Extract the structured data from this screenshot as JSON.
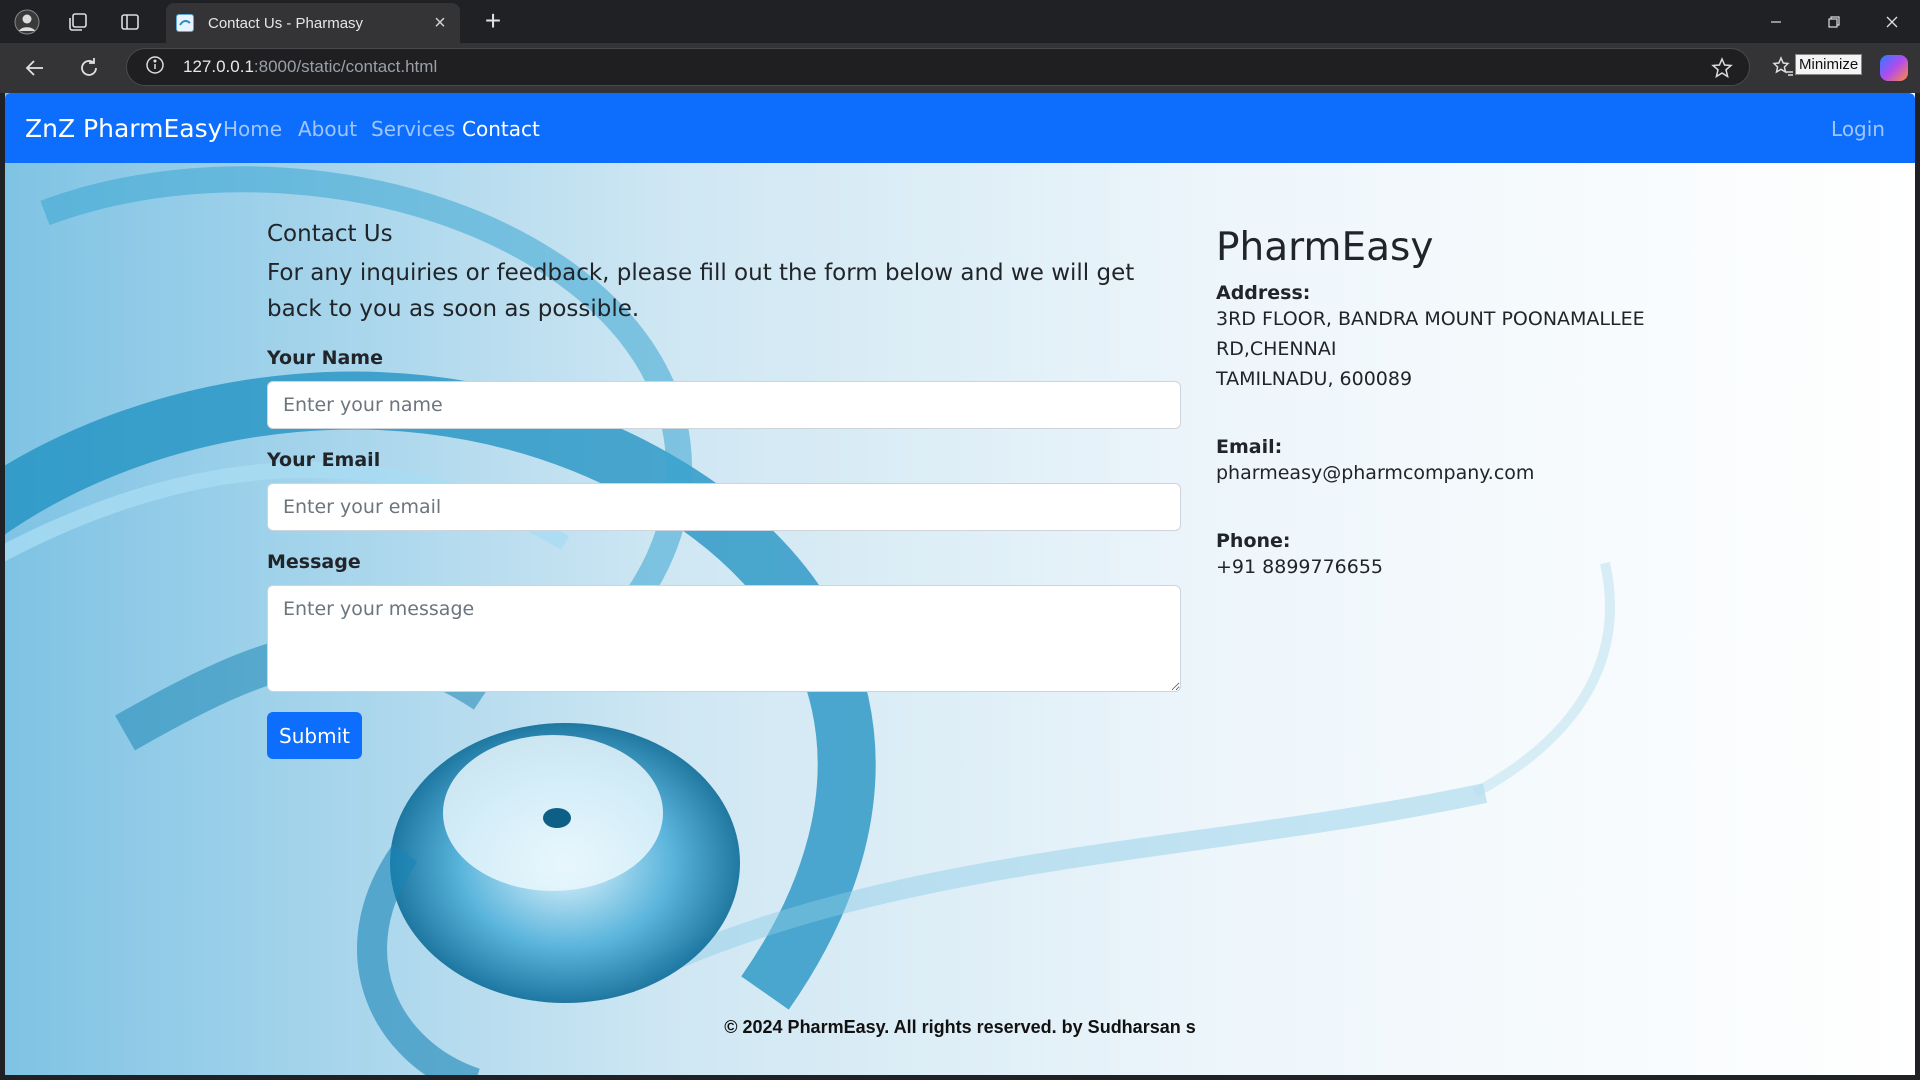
{
  "browser": {
    "tab_title": "Contact Us - Pharmasy",
    "url_host": "127.0.0.1",
    "url_rest": ":8000/static/contact.html",
    "tooltip": "Minimize",
    "icons": [
      "profile-icon",
      "workspaces-icon",
      "tab-actions-icon",
      "close-icon",
      "new-tab-icon",
      "back-icon",
      "reload-icon",
      "site-info-icon",
      "favorite-star-icon",
      "favorites-icon",
      "copilot-icon",
      "minimize-icon",
      "restore-icon",
      "window-close-icon"
    ]
  },
  "navbar": {
    "brand": "ZnZ PharmEasy",
    "links": [
      "Home",
      "About",
      "Services",
      "Contact"
    ],
    "active": "Contact",
    "login": "Login",
    "color": "#0d6efd"
  },
  "form": {
    "title": "Contact Us",
    "intro": "For any inquiries or feedback, please fill out the form below and we will get back to you as soon as possible.",
    "name_label": "Your Name",
    "name_placeholder": "Enter your name",
    "email_label": "Your Email",
    "email_placeholder": "Enter your email",
    "message_label": "Message",
    "message_placeholder": "Enter your message",
    "submit_label": "Submit"
  },
  "info": {
    "title": "PharmEasy",
    "address_label": "Address:",
    "address_line1": "3RD FLOOR, BANDRA MOUNT POONAMALLEE",
    "address_line2": "RD,CHENNAI",
    "address_line3": "TAMILNADU, 600089",
    "email_label": "Email:",
    "email": "pharmeasy@pharmcompany.com",
    "phone_label": "Phone:",
    "phone": "+91 8899776655"
  },
  "footer": {
    "text": "© 2024 PharmEasy. All rights reserved. by Sudharsan s"
  }
}
